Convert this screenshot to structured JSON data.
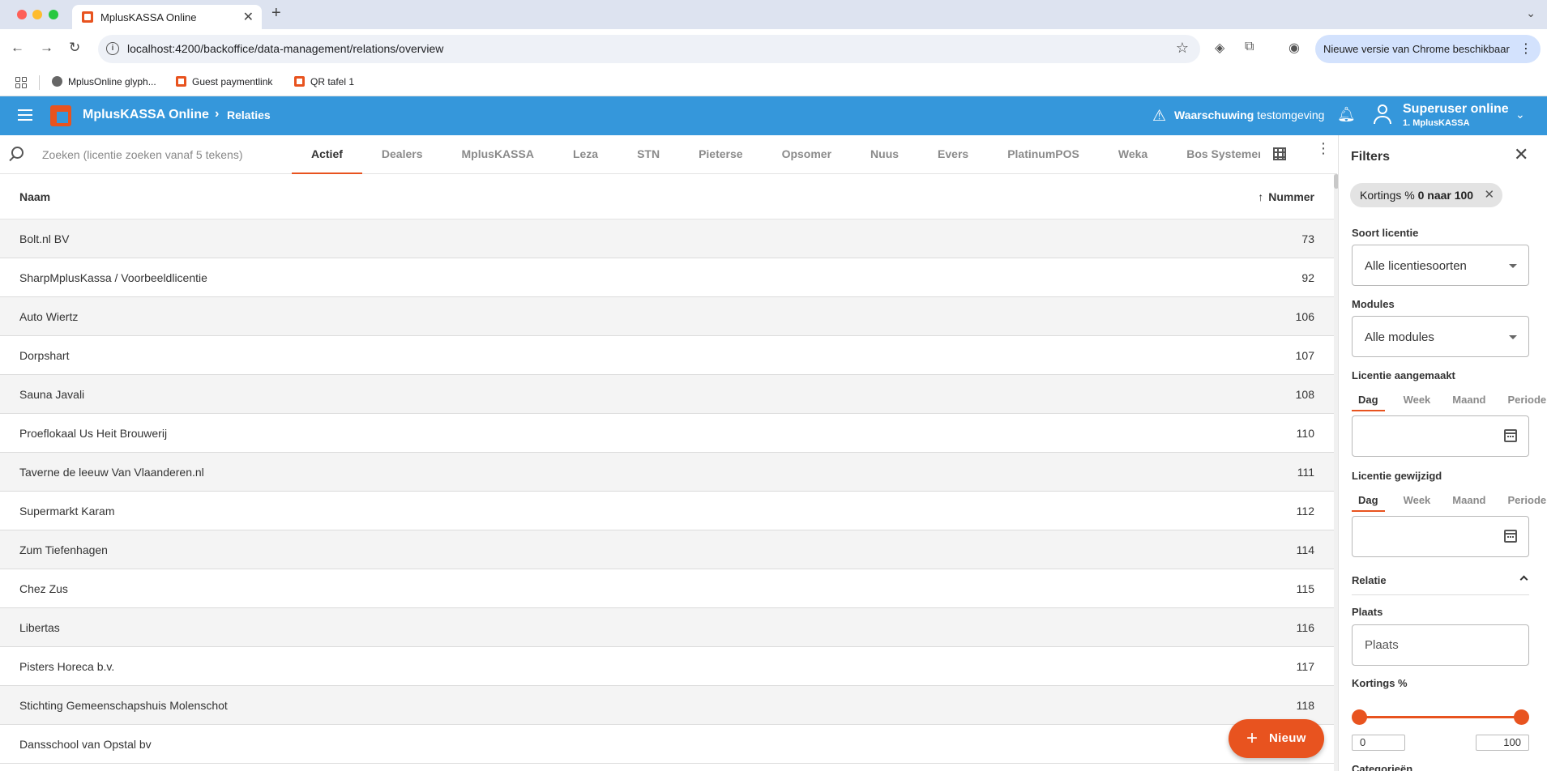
{
  "browser": {
    "tab_title": "MplusKASSA Online",
    "url": "localhost:4200/backoffice/data-management/relations/overview",
    "update_label": "Nieuwe versie van Chrome beschikbaar",
    "bookmarks": [
      "MplusOnline glyph...",
      "Guest paymentlink",
      "QR tafel 1"
    ]
  },
  "app": {
    "title": "MplusKASSA Online",
    "breadcrumb": "Relaties",
    "warning_bold": "Waarschuwing",
    "warning_text": "testomgeving",
    "user_name": "Superuser online",
    "user_org": "1. MplusKASSA"
  },
  "search": {
    "placeholder": "Zoeken (licentie zoeken vanaf 5 tekens)"
  },
  "tabs": [
    "Actief",
    "Dealers",
    "MplusKASSA",
    "Leza",
    "STN",
    "Pieterse",
    "Opsomer",
    "Nuus",
    "Evers",
    "PlatinumPOS",
    "Weka",
    "Bos Systemen"
  ],
  "table": {
    "col_name": "Naam",
    "col_number": "Nummer",
    "rows": [
      {
        "name": "Bolt.nl BV",
        "number": "73"
      },
      {
        "name": "SharpMplusKassa / Voorbeeldlicentie",
        "number": "92"
      },
      {
        "name": "Auto Wiertz",
        "number": "106"
      },
      {
        "name": "Dorpshart",
        "number": "107"
      },
      {
        "name": "Sauna Javali",
        "number": "108"
      },
      {
        "name": "Proeflokaal Us Heit Brouwerij",
        "number": "110"
      },
      {
        "name": "Taverne de leeuw Van Vlaanderen.nl",
        "number": "111"
      },
      {
        "name": "Supermarkt Karam",
        "number": "112"
      },
      {
        "name": "Zum Tiefenhagen",
        "number": "114"
      },
      {
        "name": "Chez Zus",
        "number": "115"
      },
      {
        "name": "Libertas",
        "number": "116"
      },
      {
        "name": "Pisters Horeca b.v.",
        "number": "117"
      },
      {
        "name": "Stichting Gemeenschapshuis Molenschot",
        "number": "118"
      },
      {
        "name": "Dansschool van Opstal bv",
        "number": ""
      }
    ]
  },
  "fab": {
    "label": "Nieuw"
  },
  "filters": {
    "title": "Filters",
    "chip_prefix": "Kortings %",
    "chip_value": "0 naar 100",
    "soort_label": "Soort licentie",
    "soort_value": "Alle licentiesoorten",
    "modules_label": "Modules",
    "modules_value": "Alle modules",
    "created_label": "Licentie aangemaakt",
    "changed_label": "Licentie gewijzigd",
    "periods": [
      "Dag",
      "Week",
      "Maand",
      "Periode"
    ],
    "relatie_label": "Relatie",
    "plaats_label": "Plaats",
    "plaats_placeholder": "Plaats",
    "kortings_label": "Kortings %",
    "range_min": "0",
    "range_max": "100",
    "next_label": "Categorieën"
  }
}
